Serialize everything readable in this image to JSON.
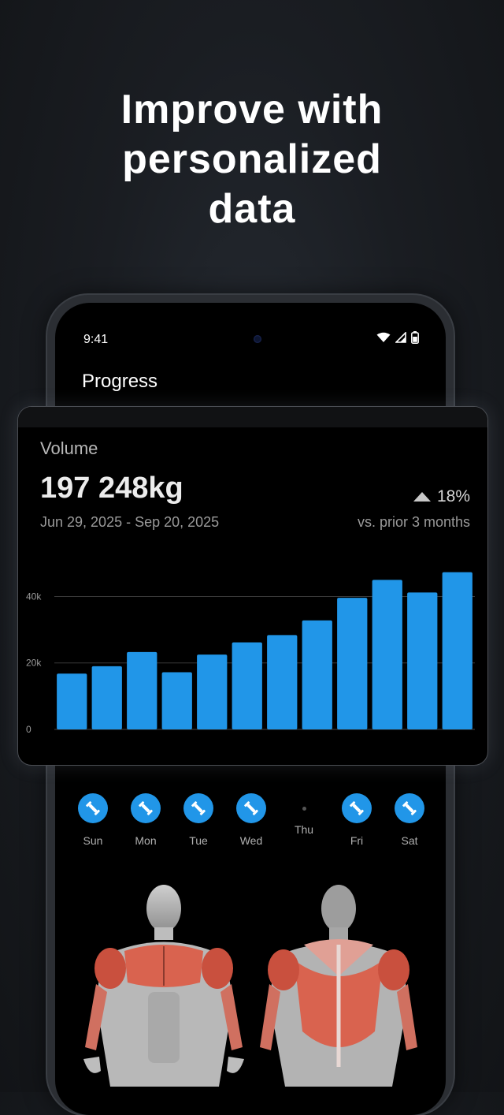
{
  "headline": {
    "line1": "Improve with",
    "line2": "personalized",
    "line3": "data"
  },
  "status_bar": {
    "time": "9:41",
    "icons": [
      "wifi-icon",
      "signal-icon",
      "battery-icon"
    ]
  },
  "app": {
    "title": "Progress"
  },
  "volume_card": {
    "label": "Volume",
    "value": "197 248kg",
    "date_range": "Jun 29, 2025 - Sep 20, 2025",
    "change": "18%",
    "change_direction": "up",
    "comparison": "vs. prior 3 months"
  },
  "chart_data": {
    "type": "bar",
    "title": "",
    "xlabel": "",
    "ylabel": "",
    "ylim": [
      0,
      50000
    ],
    "yticks": [
      "0",
      "20k",
      "40k"
    ],
    "ytick_values": [
      0,
      20000,
      40000
    ],
    "grid": true,
    "color": "#2196e8",
    "values": [
      16800,
      19000,
      23300,
      17200,
      22500,
      26200,
      28400,
      32800,
      39600,
      45000,
      41200,
      47300
    ]
  },
  "weekdays": [
    {
      "label": "Sun",
      "worked_out": true
    },
    {
      "label": "Mon",
      "worked_out": true
    },
    {
      "label": "Tue",
      "worked_out": true
    },
    {
      "label": "Wed",
      "worked_out": true
    },
    {
      "label": "Thu",
      "worked_out": false
    },
    {
      "label": "Fri",
      "worked_out": true
    },
    {
      "label": "Sat",
      "worked_out": true
    }
  ],
  "colors": {
    "accent": "#2196e8",
    "background": "#000000",
    "muscle_highlight": "#d9634f"
  }
}
